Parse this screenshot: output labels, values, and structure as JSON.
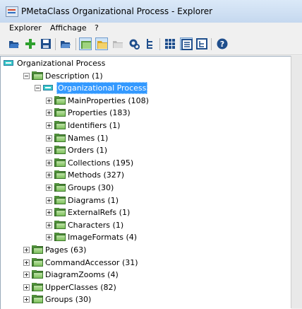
{
  "window": {
    "title": "PMetaClass Organizational Process - Explorer"
  },
  "menu": [
    {
      "label": "Explorer"
    },
    {
      "label": "Affichage"
    },
    {
      "label": "?"
    }
  ],
  "toolbar": [
    {
      "icon": "open-folder-icon"
    },
    {
      "icon": "add-icon"
    },
    {
      "icon": "save-icon"
    },
    {
      "icon": "open-file-icon"
    },
    {
      "icon": "view-large-icons-icon",
      "pressed": true
    },
    {
      "icon": "view-folder-icon",
      "pressed": true
    },
    {
      "icon": "folder-icon"
    },
    {
      "icon": "settings-icon"
    },
    {
      "icon": "hierarchy-icon"
    },
    {
      "icon": "grid-view-icon"
    },
    {
      "icon": "details-view-icon",
      "pressed": true
    },
    {
      "icon": "tree-view-icon"
    },
    {
      "icon": "help-icon"
    }
  ],
  "tree": [
    {
      "label": "Organizational Process",
      "level": 0,
      "icon": "class",
      "expander": "none"
    },
    {
      "label": "Description (1)",
      "level": 1,
      "icon": "folder",
      "expander": "minus"
    },
    {
      "label": "Organizational Process",
      "level": 2,
      "icon": "class",
      "expander": "minus",
      "selected": true
    },
    {
      "label": "MainProperties (108)",
      "level": 3,
      "icon": "folder",
      "expander": "plus"
    },
    {
      "label": "Properties (183)",
      "level": 3,
      "icon": "folder",
      "expander": "plus"
    },
    {
      "label": "Identifiers (1)",
      "level": 3,
      "icon": "folder",
      "expander": "plus"
    },
    {
      "label": "Names (1)",
      "level": 3,
      "icon": "folder",
      "expander": "plus"
    },
    {
      "label": "Orders (1)",
      "level": 3,
      "icon": "folder",
      "expander": "plus"
    },
    {
      "label": "Collections (195)",
      "level": 3,
      "icon": "folder",
      "expander": "plus"
    },
    {
      "label": "Methods (327)",
      "level": 3,
      "icon": "folder",
      "expander": "plus"
    },
    {
      "label": "Groups (30)",
      "level": 3,
      "icon": "folder",
      "expander": "plus"
    },
    {
      "label": "Diagrams (1)",
      "level": 3,
      "icon": "folder",
      "expander": "plus"
    },
    {
      "label": "ExternalRefs (1)",
      "level": 3,
      "icon": "folder",
      "expander": "plus"
    },
    {
      "label": "Characters (1)",
      "level": 3,
      "icon": "folder",
      "expander": "plus"
    },
    {
      "label": "ImageFormats (4)",
      "level": 3,
      "icon": "folder",
      "expander": "plus"
    },
    {
      "label": "Pages (63)",
      "level": 1,
      "icon": "folder",
      "expander": "plus"
    },
    {
      "label": "CommandAccessor (31)",
      "level": 1,
      "icon": "folder",
      "expander": "plus"
    },
    {
      "label": "DiagramZooms (4)",
      "level": 1,
      "icon": "folder",
      "expander": "plus"
    },
    {
      "label": "UpperClasses (82)",
      "level": 1,
      "icon": "folder",
      "expander": "plus"
    },
    {
      "label": "Groups (30)",
      "level": 1,
      "icon": "folder",
      "expander": "plus"
    }
  ]
}
